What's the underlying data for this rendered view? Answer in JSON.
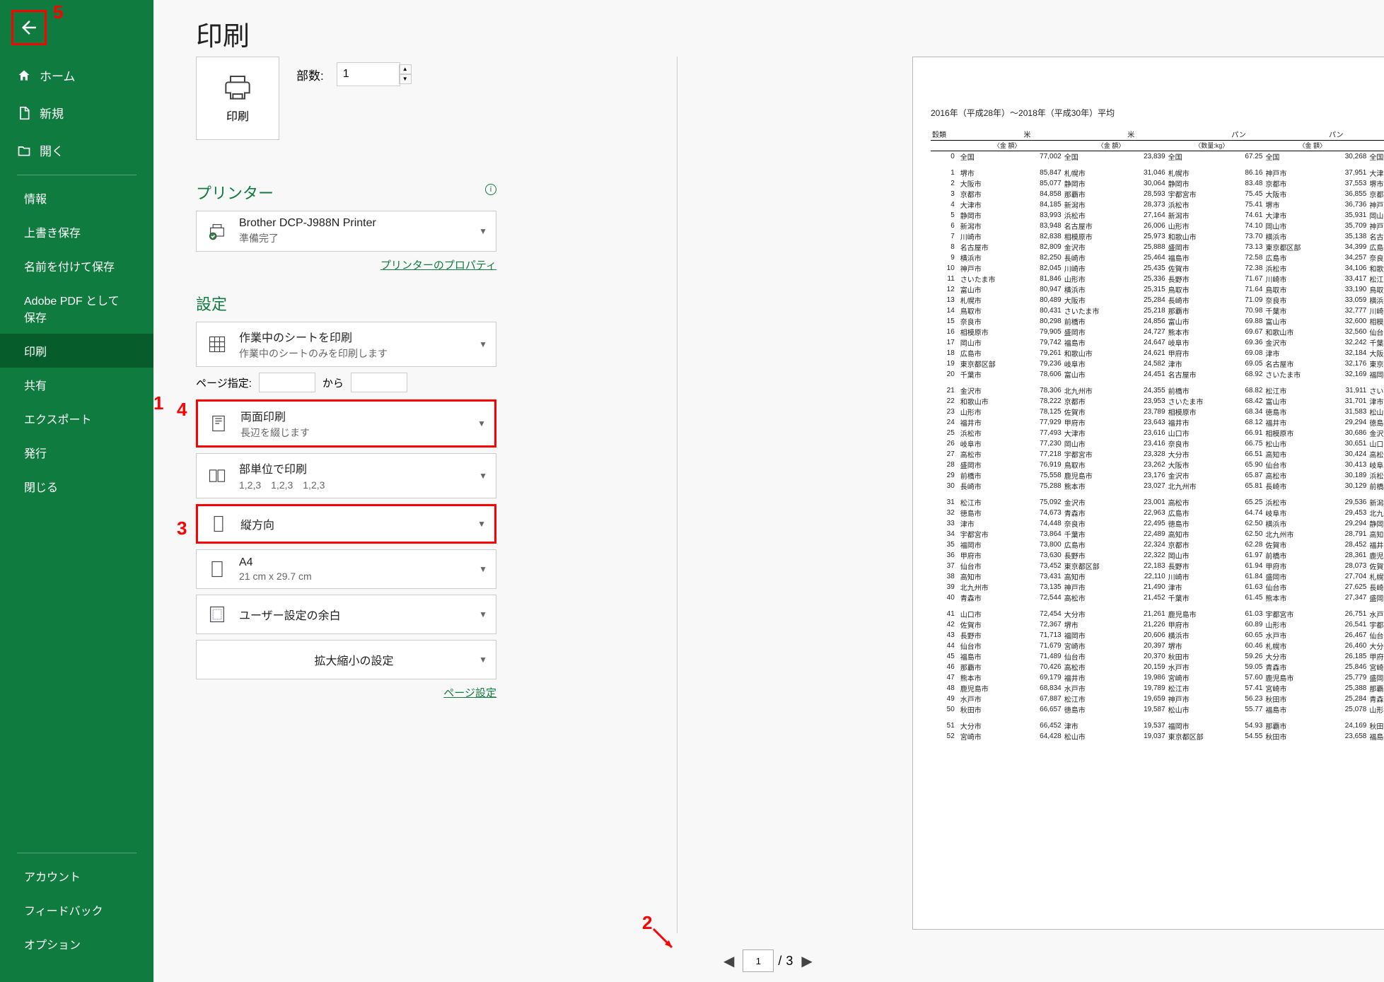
{
  "sidebar": {
    "home": "ホーム",
    "new": "新規",
    "open": "開く",
    "info": "情報",
    "save": "上書き保存",
    "saveas": "名前を付けて保存",
    "savepdf": "Adobe PDF として保存",
    "print": "印刷",
    "share": "共有",
    "export": "エクスポート",
    "publish": "発行",
    "close": "閉じる",
    "account": "アカウント",
    "feedback": "フィードバック",
    "options": "オプション"
  },
  "title": "印刷",
  "print_button": "印刷",
  "copies_label": "部数:",
  "copies_value": "1",
  "printer_header": "プリンター",
  "printer_name": "Brother DCP-J988N Printer",
  "printer_status": "準備完了",
  "printer_props": "プリンターのプロパティ",
  "settings_header": "設定",
  "setting_print_sheets": {
    "title": "作業中のシートを印刷",
    "sub": "作業中のシートのみを印刷します"
  },
  "page_range_label": "ページ指定:",
  "page_range_to": "から",
  "setting_duplex": {
    "title": "両面印刷",
    "sub": "長辺を綴じます"
  },
  "setting_collate": {
    "title": "部単位で印刷",
    "sub": "1,2,3　1,2,3　1,2,3"
  },
  "setting_orientation": {
    "title": "縦方向"
  },
  "setting_paper": {
    "title": "A4",
    "sub": "21 cm x 29.7 cm"
  },
  "setting_margins": {
    "title": "ユーザー設定の余白"
  },
  "setting_scaling": {
    "title": "拡大縮小の設定"
  },
  "page_setup_link": "ページ設定",
  "pager": {
    "current": "1",
    "total": "3"
  },
  "preview_title": "2016年（平成28年）～2018年（平成30年）平均",
  "columns": [
    "穀類",
    "",
    "米",
    "",
    "米",
    "",
    "パン",
    "",
    "パン",
    ""
  ],
  "sub_columns": [
    "",
    "〈金 額〉",
    "",
    "〈金 額〉",
    "",
    "〈数量:kg〉",
    "",
    "〈金 額〉",
    "",
    "〈"
  ],
  "rows": [
    [
      "0",
      "全国",
      "77,002",
      "全国",
      "23,839",
      "全国",
      "67.25",
      "全国",
      "30,268",
      "全国"
    ],
    [
      "1",
      "堺市",
      "85,847",
      "札幌市",
      "31,046",
      "札幌市",
      "86.16",
      "神戸市",
      "37,951",
      "大津市"
    ],
    [
      "2",
      "大阪市",
      "85,077",
      "静岡市",
      "30,064",
      "静岡市",
      "83.48",
      "京都市",
      "37,553",
      "堺市"
    ],
    [
      "3",
      "京都市",
      "84,858",
      "那覇市",
      "28,593",
      "宇都宮市",
      "75.45",
      "大阪市",
      "36,855",
      "京都市"
    ],
    [
      "4",
      "大津市",
      "84,185",
      "新潟市",
      "28,373",
      "浜松市",
      "75.41",
      "堺市",
      "36,736",
      "神戸市"
    ],
    [
      "5",
      "静岡市",
      "83,993",
      "浜松市",
      "27,164",
      "新潟市",
      "74.61",
      "大津市",
      "35,931",
      "岡山市"
    ],
    [
      "6",
      "新潟市",
      "83,948",
      "名古屋市",
      "26,006",
      "山形市",
      "74.10",
      "岡山市",
      "35,709",
      "神戸市"
    ],
    [
      "7",
      "川崎市",
      "82,838",
      "相模原市",
      "25,973",
      "和歌山市",
      "73.70",
      "横浜市",
      "35,138",
      "名古屋市"
    ],
    [
      "8",
      "名古屋市",
      "82,809",
      "金沢市",
      "25,888",
      "盛岡市",
      "73.13",
      "東京都区部",
      "34,399",
      "広島市"
    ],
    [
      "9",
      "横浜市",
      "82,250",
      "長崎市",
      "25,464",
      "福島市",
      "72.58",
      "広島市",
      "34,257",
      "奈良市"
    ],
    [
      "10",
      "神戸市",
      "82,045",
      "川崎市",
      "25,435",
      "佐賀市",
      "72.38",
      "浜松市",
      "34,106",
      "和歌山市"
    ],
    [
      "11",
      "さいたま市",
      "81,846",
      "山形市",
      "25,336",
      "長野市",
      "71.67",
      "川崎市",
      "33,417",
      "松江市"
    ],
    [
      "12",
      "富山市",
      "80,947",
      "横浜市",
      "25,315",
      "鳥取市",
      "71.64",
      "鳥取市",
      "33,190",
      "鳥取市"
    ],
    [
      "13",
      "札幌市",
      "80,489",
      "大阪市",
      "25,284",
      "長崎市",
      "71.09",
      "奈良市",
      "33,059",
      "横浜市"
    ],
    [
      "14",
      "鳥取市",
      "80,431",
      "さいたま市",
      "25,218",
      "那覇市",
      "70.98",
      "千葉市",
      "32,777",
      "川崎市"
    ],
    [
      "15",
      "奈良市",
      "80,298",
      "前橋市",
      "24,856",
      "富山市",
      "69.88",
      "富山市",
      "32,600",
      "相模原市"
    ],
    [
      "16",
      "相模原市",
      "79,905",
      "盛岡市",
      "24,727",
      "熊本市",
      "69.67",
      "和歌山市",
      "32,560",
      "仙台市"
    ],
    [
      "17",
      "岡山市",
      "79,742",
      "福島市",
      "24,647",
      "岐阜市",
      "69.36",
      "金沢市",
      "32,242",
      "千葉市"
    ],
    [
      "18",
      "広島市",
      "79,261",
      "和歌山市",
      "24,621",
      "甲府市",
      "69.08",
      "津市",
      "32,184",
      "大阪市"
    ],
    [
      "19",
      "東京都区部",
      "79,236",
      "岐阜市",
      "24,582",
      "津市",
      "69.05",
      "名古屋市",
      "32,176",
      "東京都区部"
    ],
    [
      "20",
      "千葉市",
      "78,606",
      "富山市",
      "24,451",
      "名古屋市",
      "68.92",
      "さいたま市",
      "32,169",
      "福岡市"
    ],
    [
      "21",
      "金沢市",
      "78,306",
      "北九州市",
      "24,355",
      "前橋市",
      "68.82",
      "松江市",
      "31,911",
      "さいたま市"
    ],
    [
      "22",
      "和歌山市",
      "78,222",
      "京都市",
      "23,953",
      "さいたま市",
      "68.42",
      "富山市",
      "31,701",
      "津市"
    ],
    [
      "23",
      "山形市",
      "78,125",
      "佐賀市",
      "23,789",
      "相模原市",
      "68.34",
      "徳島市",
      "31,583",
      "松山市"
    ],
    [
      "24",
      "福井市",
      "77,929",
      "甲府市",
      "23,643",
      "福井市",
      "68.12",
      "福井市",
      "29,294",
      "徳島市"
    ],
    [
      "25",
      "浜松市",
      "77,493",
      "大津市",
      "23,616",
      "山口市",
      "66.91",
      "相模原市",
      "30,686",
      "金沢市"
    ],
    [
      "26",
      "岐阜市",
      "77,230",
      "岡山市",
      "23,416",
      "奈良市",
      "66.75",
      "松山市",
      "30,651",
      "山口市"
    ],
    [
      "27",
      "高松市",
      "77,218",
      "宇都宮市",
      "23,328",
      "大分市",
      "66.51",
      "高知市",
      "30,424",
      "高松市"
    ],
    [
      "28",
      "盛岡市",
      "76,919",
      "鳥取市",
      "23,262",
      "大阪市",
      "65.90",
      "仙台市",
      "30,413",
      "岐阜市"
    ],
    [
      "29",
      "前橋市",
      "75,558",
      "鹿児島市",
      "23,176",
      "金沢市",
      "65.87",
      "高松市",
      "30,189",
      "浜松市"
    ],
    [
      "30",
      "長崎市",
      "75,288",
      "熊本市",
      "23,027",
      "北九州市",
      "65.81",
      "長崎市",
      "30,129",
      "前橋市"
    ],
    [
      "31",
      "松江市",
      "75,092",
      "金沢市",
      "23,001",
      "高松市",
      "65.25",
      "浜松市",
      "29,536",
      "新潟市"
    ],
    [
      "32",
      "徳島市",
      "74,673",
      "青森市",
      "22,963",
      "広島市",
      "64.74",
      "岐阜市",
      "29,453",
      "北九州市"
    ],
    [
      "33",
      "津市",
      "74,448",
      "奈良市",
      "22,495",
      "徳島市",
      "62.50",
      "横浜市",
      "29,294",
      "静岡市"
    ],
    [
      "34",
      "宇都宮市",
      "73,864",
      "千葉市",
      "22,489",
      "高知市",
      "62.50",
      "北九州市",
      "28,791",
      "高知市"
    ],
    [
      "35",
      "福岡市",
      "73,800",
      "広島市",
      "22,324",
      "京都市",
      "62.28",
      "佐賀市",
      "28,452",
      "福井市"
    ],
    [
      "36",
      "甲府市",
      "73,630",
      "長野市",
      "22,322",
      "岡山市",
      "61.97",
      "前橋市",
      "28,361",
      "鹿児島市"
    ],
    [
      "37",
      "仙台市",
      "73,452",
      "東京都区部",
      "22,183",
      "長野市",
      "61.94",
      "甲府市",
      "28,073",
      "佐賀市"
    ],
    [
      "38",
      "高知市",
      "73,431",
      "高知市",
      "22,110",
      "川崎市",
      "61.84",
      "盛岡市",
      "27,704",
      "札幌市"
    ],
    [
      "39",
      "北九州市",
      "73,135",
      "神戸市",
      "21,490",
      "津市",
      "61.63",
      "仙台市",
      "27,625",
      "長崎市"
    ],
    [
      "40",
      "青森市",
      "72,544",
      "高松市",
      "21,452",
      "千葉市",
      "61.45",
      "熊本市",
      "27,347",
      "盛岡市"
    ],
    [
      "41",
      "山口市",
      "72,454",
      "大分市",
      "21,261",
      "鹿児島市",
      "61.03",
      "宇都宮市",
      "26,751",
      "水戸市"
    ],
    [
      "42",
      "佐賀市",
      "72,367",
      "堺市",
      "21,226",
      "甲府市",
      "60.89",
      "山形市",
      "26,541",
      "宇都宮市"
    ],
    [
      "43",
      "長野市",
      "71,713",
      "福岡市",
      "20,606",
      "横浜市",
      "60.65",
      "水戸市",
      "26,467",
      "仙台市"
    ],
    [
      "44",
      "仙台市",
      "71,679",
      "宮崎市",
      "20,397",
      "堺市",
      "60.46",
      "札幌市",
      "26,460",
      "大分市"
    ],
    [
      "45",
      "福島市",
      "71,489",
      "仙台市",
      "20,370",
      "秋田市",
      "59.26",
      "大分市",
      "26,185",
      "甲府市"
    ],
    [
      "46",
      "那覇市",
      "70,426",
      "高松市",
      "20,159",
      "水戸市",
      "59.05",
      "青森市",
      "25,846",
      "宮崎市"
    ],
    [
      "47",
      "熊本市",
      "69,179",
      "福井市",
      "19,986",
      "宮崎市",
      "57.60",
      "鹿児島市",
      "25,779",
      "盛岡市"
    ],
    [
      "48",
      "鹿児島市",
      "68,834",
      "水戸市",
      "19,789",
      "松江市",
      "57.41",
      "宮崎市",
      "25,388",
      "那覇市"
    ],
    [
      "49",
      "水戸市",
      "67,887",
      "松江市",
      "19,659",
      "神戸市",
      "56.23",
      "秋田市",
      "25,284",
      "青森市"
    ],
    [
      "50",
      "秋田市",
      "66,657",
      "徳島市",
      "19,587",
      "松山市",
      "55.77",
      "福島市",
      "25,078",
      "山形市"
    ],
    [
      "51",
      "大分市",
      "66,452",
      "津市",
      "19,537",
      "福岡市",
      "54.93",
      "那覇市",
      "24,169",
      "秋田市"
    ],
    [
      "52",
      "宮崎市",
      "64,428",
      "松山市",
      "19,037",
      "東京都区部",
      "54.55",
      "秋田市",
      "23,658",
      "福島市"
    ]
  ],
  "callouts": {
    "c1": "1",
    "c2": "2",
    "c3": "3",
    "c4": "4",
    "c5": "5"
  }
}
